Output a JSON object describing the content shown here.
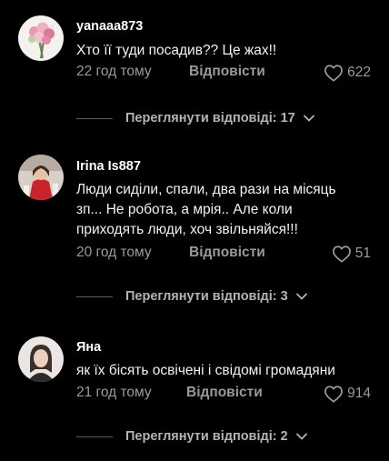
{
  "comments": [
    {
      "username": "yanaaa873",
      "text": "Хто її туди посадив?? Це жах!!",
      "time": "22 год тому",
      "reply_label": "Відповісти",
      "likes": "622",
      "view_replies": "Переглянути відповіді: 17",
      "avatar": "flowers-bouquet"
    },
    {
      "username": "Irina Is887",
      "text_lines": [
        "Люди сиділи, спали, два рази на місяць",
        "зп... Не робота, а мрія.. Але коли",
        "приходять люди, хоч звільняйся!!!"
      ],
      "time": "20 год тому",
      "reply_label": "Відповісти",
      "likes": "51",
      "view_replies": "Переглянути відповіді: 3",
      "avatar": "woman-red-outfit"
    },
    {
      "username": "Яна",
      "text": "як їх бісять освічені і свідомі громадяни",
      "time": "21 год тому",
      "reply_label": "Відповісти",
      "likes": "914",
      "view_replies": "Переглянути відповіді: 2",
      "avatar": "woman-portrait"
    }
  ],
  "icons": {
    "like": "heart-outline-icon",
    "expand": "chevron-down-icon"
  },
  "colors": {
    "background": "#000000",
    "secondary_text": "#9a9a9a"
  }
}
